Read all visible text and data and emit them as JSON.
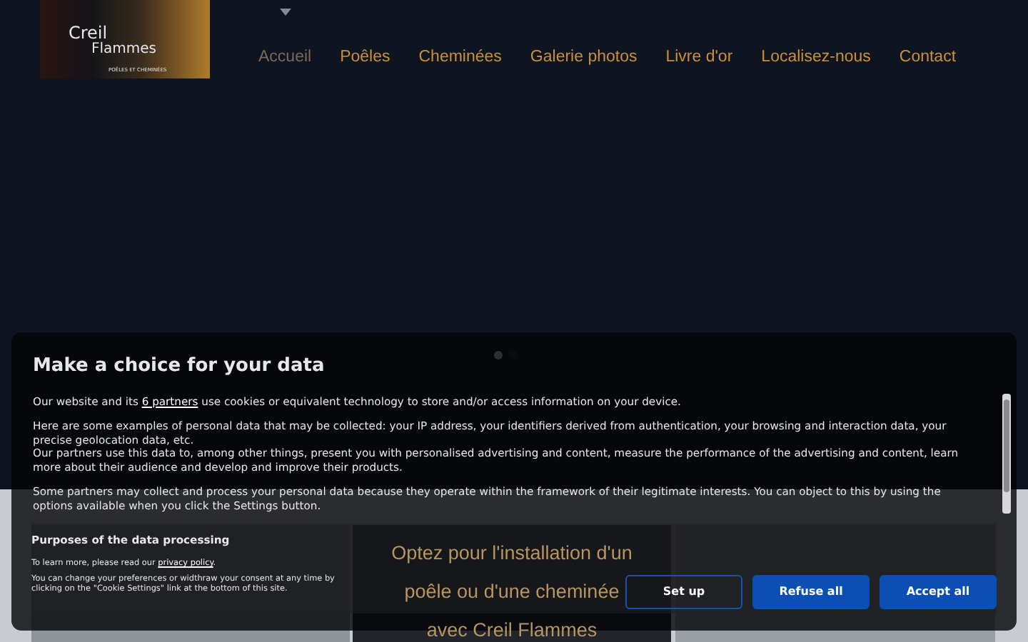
{
  "header": {
    "logo": {
      "title_line_1": "Creil",
      "title_line_2": "Flammes",
      "tagline": "POÊLES ET CHEMINÉES"
    },
    "nav": [
      {
        "label": "Accueil",
        "selected": true
      },
      {
        "label": "Poêles",
        "selected": false
      },
      {
        "label": "Cheminées",
        "selected": false
      },
      {
        "label": "Galerie photos",
        "selected": false
      },
      {
        "label": "Livre d'or",
        "selected": false
      },
      {
        "label": "Localisez-nous",
        "selected": false
      },
      {
        "label": "Contact",
        "selected": false
      }
    ]
  },
  "slider": {
    "dots": [
      {
        "selected": true
      },
      {
        "selected": false
      }
    ]
  },
  "hero": {
    "heading_lines": [
      "Optez pour l'installation d'un",
      "poêle ou d'une cheminée",
      "avec Creil Flammes"
    ]
  },
  "consent": {
    "title": "Make a choice for your data",
    "intro": {
      "before": "Our website and its ",
      "link": "6 partners",
      "after": " use cookies or equivalent technology to store and/or access information on your device."
    },
    "paragraphs": [
      [
        "Here are some examples of personal data that may be collected: your IP address, your identifiers derived from authentication, your browsing and interaction data, your precise geolocation data, etc.",
        "Our partners use this data to, among other things, present you with personalised advertising and content, measure the performance of the advertising and content, learn more about their audience and develop and improve their products."
      ],
      [
        "Some partners may collect and process your personal data because they operate within the framework of their legitimate interests. You can object to this by using the options available when you click the Settings button."
      ]
    ],
    "purposes": {
      "heading": "Purposes of the data processing",
      "privacy": {
        "before": "To learn more, please read our ",
        "link": "privacy policy",
        "after": "."
      },
      "note": "You can change your preferences or widthraw your consent at any time by clicking on the \"Cookie Settings\" link at the bottom of this site."
    },
    "buttons": [
      {
        "label": "Set up",
        "kind": "outline"
      },
      {
        "label": "Refuse all",
        "kind": "solid"
      },
      {
        "label": "Accept all",
        "kind": "solid"
      }
    ]
  }
}
